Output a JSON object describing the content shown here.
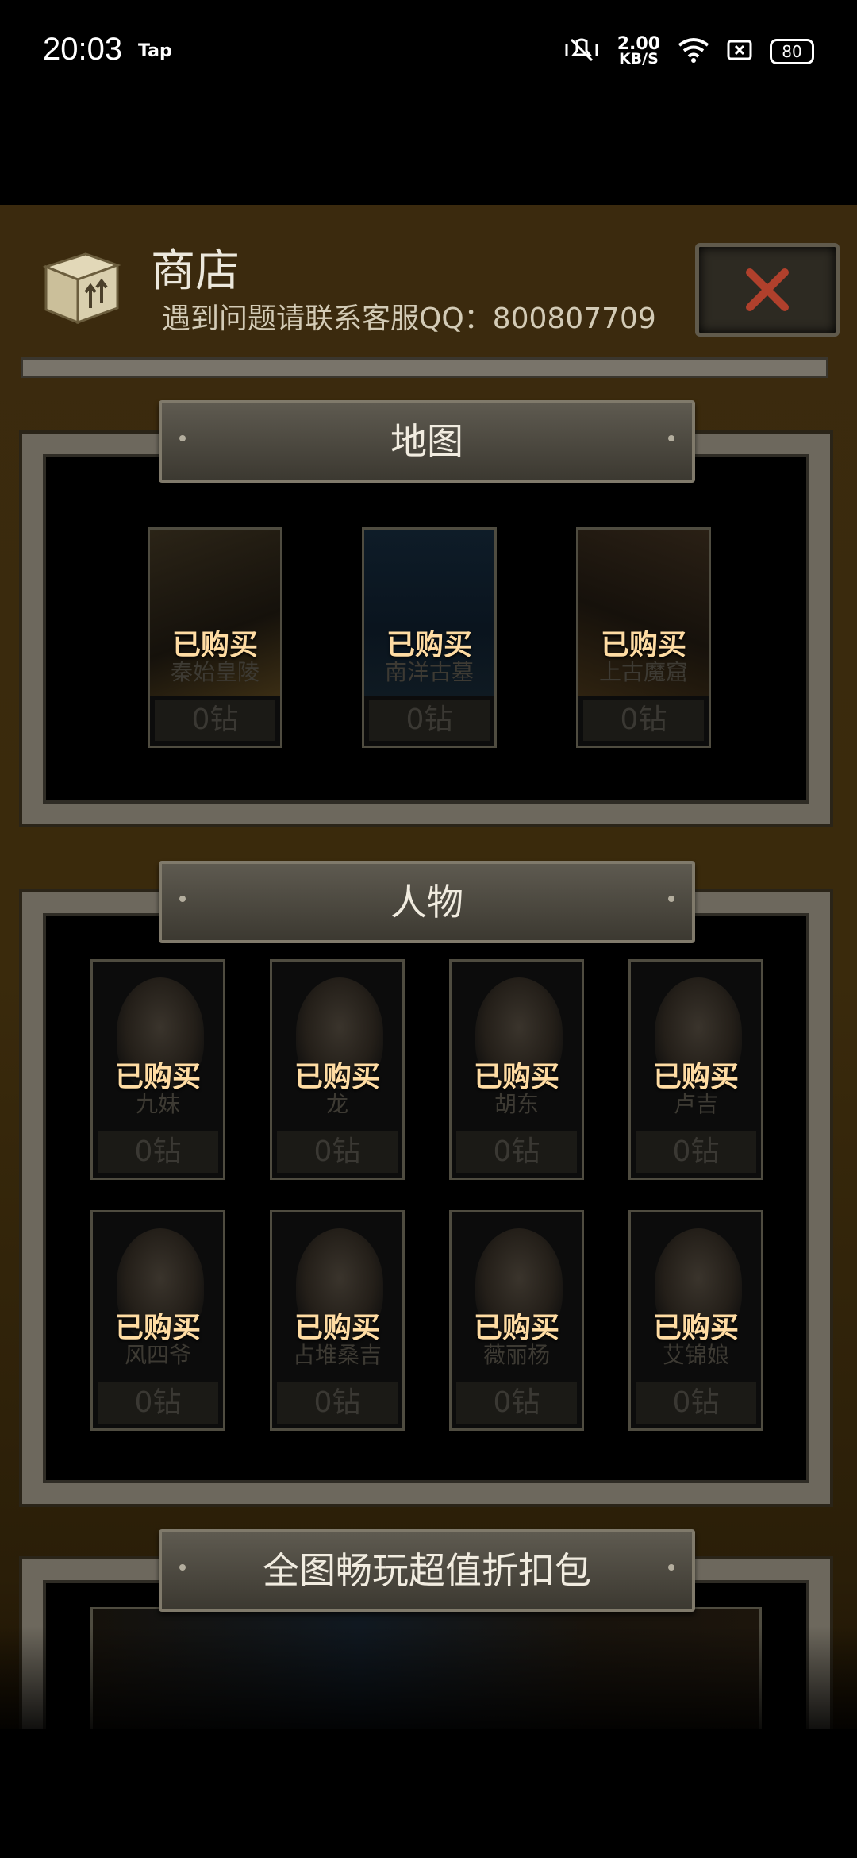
{
  "status_bar": {
    "time": "20:03",
    "app": "Tap",
    "speed_value": "2.00",
    "speed_unit": "KB/S",
    "battery": "80"
  },
  "shop": {
    "title": "商店",
    "subtitle": "遇到问题请联系客服QQ：800807709",
    "sections": [
      {
        "title": "地图",
        "items": [
          {
            "name": "秦始皇陵",
            "status": "已购买",
            "price": "0钻"
          },
          {
            "name": "南洋古墓",
            "status": "已购买",
            "price": "0钻"
          },
          {
            "name": "上古魔窟",
            "status": "已购买",
            "price": "0钻"
          }
        ]
      },
      {
        "title": "人物",
        "items": [
          {
            "name": "九妹",
            "status": "已购买",
            "price": "0钻"
          },
          {
            "name": "龙",
            "status": "已购买",
            "price": "0钻"
          },
          {
            "name": "胡东",
            "status": "已购买",
            "price": "0钻"
          },
          {
            "name": "卢吉",
            "status": "已购买",
            "price": "0钻"
          },
          {
            "name": "风四爷",
            "status": "已购买",
            "price": "0钻"
          },
          {
            "name": "占堆桑吉",
            "status": "已购买",
            "price": "0钻"
          },
          {
            "name": "薇丽杨",
            "status": "已购买",
            "price": "0钻"
          },
          {
            "name": "艾锦娘",
            "status": "已购买",
            "price": "0钻"
          }
        ]
      },
      {
        "title": "全图畅玩超值折扣包"
      }
    ]
  }
}
